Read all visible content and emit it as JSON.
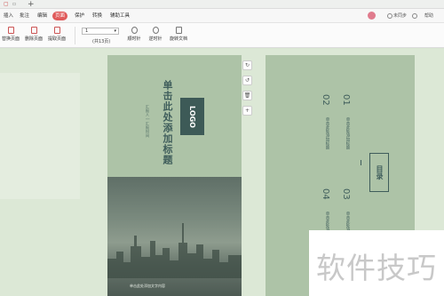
{
  "menu": {
    "items": [
      "插入",
      "批注",
      "编辑",
      "页面",
      "保护",
      "转换",
      "辅助工具"
    ],
    "active_index": 3,
    "right": [
      "未同步",
      "帮助"
    ]
  },
  "ribbon": {
    "buttons": [
      "替换页面",
      "删除页面",
      "提取页面"
    ],
    "page_value": "1",
    "total": "(共13页)",
    "rotate": [
      "顺时针",
      "逆时针",
      "旋转文档"
    ]
  },
  "cover": {
    "logo": "LOGO",
    "title": "单击此处添加标题",
    "subtitle": "汇报人 | 汇报时间",
    "caption": "单击此处添加文字内容"
  },
  "toc": {
    "heading": "目录",
    "entries": [
      {
        "num": "01",
        "text": "单击此处添加标题"
      },
      {
        "num": "02",
        "text": "单击此处添加标题"
      },
      {
        "num": "03",
        "text": "单击此处添加标题"
      },
      {
        "num": "04",
        "text": "单击此处添加标题"
      }
    ]
  },
  "watermark": "软件技巧",
  "colors": {
    "accent": "#e05a5a",
    "slide_bg": "#adc3a7",
    "slide_text": "#3f5d5b",
    "logo_bg": "#3d5a57"
  }
}
